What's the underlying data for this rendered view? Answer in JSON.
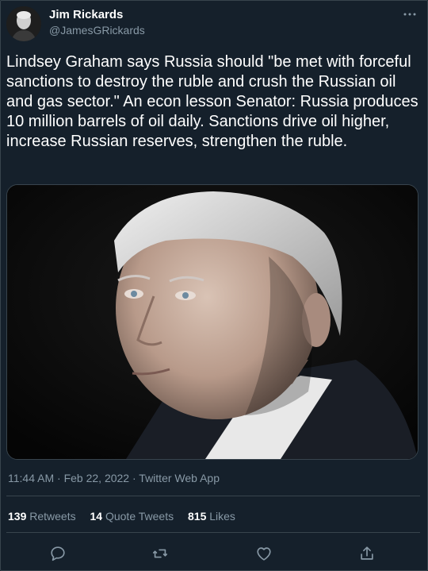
{
  "author": {
    "name": "Jim Rickards",
    "handle": "@JamesGRickards"
  },
  "tweet": {
    "text": "Lindsey Graham says Russia should \"be met with forceful sanctions to destroy the ruble and crush the Russian oil and gas sector.\" An econ lesson Senator: Russia produces 10 million barrels of oil daily. Sanctions drive oil higher, increase Russian reserves, strengthen the ruble."
  },
  "meta": {
    "time": "11:44 AM",
    "separator": "·",
    "date": "Feb 22, 2022",
    "app": "Twitter Web App"
  },
  "stats": {
    "retweets_count": "139",
    "retweets_label": "Retweets",
    "quotes_count": "14",
    "quotes_label": "Quote Tweets",
    "likes_count": "815",
    "likes_label": "Likes"
  },
  "icons": {
    "more": "more-horizontal-icon",
    "reply": "reply-icon",
    "retweet": "retweet-icon",
    "like": "heart-icon",
    "share": "share-icon"
  },
  "colors": {
    "background": "#15202b",
    "secondary_text": "#8899a6",
    "border": "#38444d"
  }
}
